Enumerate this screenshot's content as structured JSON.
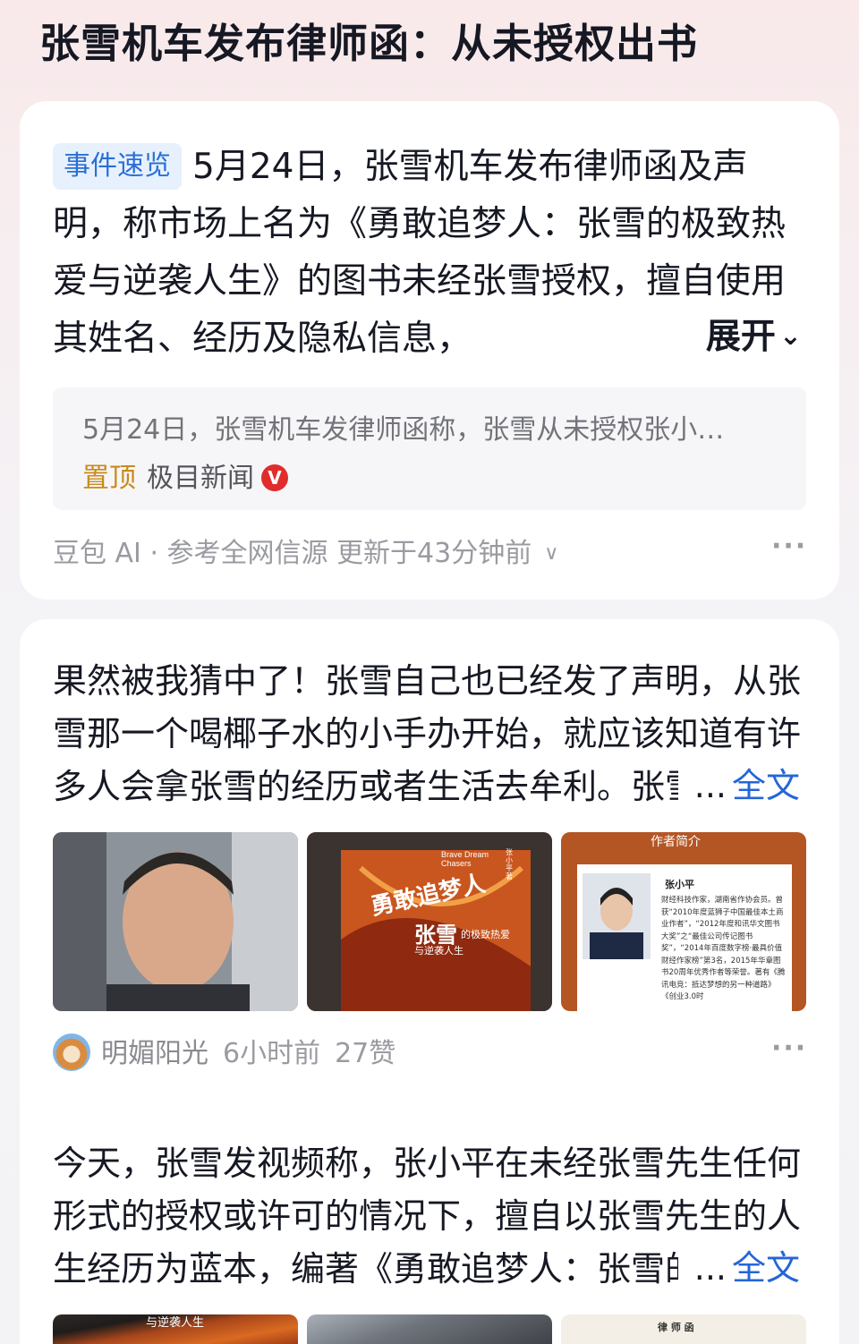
{
  "page": {
    "title": "张雪机车发布律师函：从未授权出书"
  },
  "summary": {
    "tag": "事件速览",
    "text": "5月24日，张雪机车发布律师函及声明，称市场上名为《勇敢追梦人：张雪的极致热爱与逆袭人生》的图书未经张雪授权，擅自使用其姓名、经历及隐私信息，",
    "expand_label": "展开",
    "quote": {
      "text": "5月24日，张雪机车发律师函称，张雪从未授权张小…",
      "pin_label": "置顶",
      "source": "极目新闻",
      "verified_mark": "V"
    },
    "footer": {
      "ai_source": "豆包 AI · 参考全网信源",
      "updated": "更新于43分钟前"
    },
    "more": "···"
  },
  "posts": [
    {
      "text": "果然被我猜中了！张雪自己也已经发了声明，从张雪那一个喝椰子水的小手办开始，就应该知道有许多人会拿张雪的经历或者生活去牟利。张雪",
      "ellipsis": "...",
      "full_label": "全文",
      "images": [
        {
          "alt": "portrait-photo",
          "caption": ""
        },
        {
          "alt": "book-cover",
          "en_title": "Brave Dream Chasers",
          "cn_title": "勇敢追梦人",
          "name": "张雪",
          "subtitle": "的极致热爱",
          "subtitle2": "与逆袭人生",
          "author_vertical": "张小平 著"
        },
        {
          "alt": "author-intro-page",
          "header": "作者简介",
          "author": "张小平",
          "bio": "财经科技作家，湖南省作协会员。曾获“2010年度蓝狮子中国最佳本土商业作者”，“2012年度和讯华文图书大奖”之“最佳公司传记图书奖”，“2014年百度数字榜·最具价值财经作家榜”第3名，2015年华章图书20周年优秀作者等荣誉。著有《腾讯电竞：抵达梦想的另一种道路》《创业3.0时"
        }
      ],
      "author": "明媚阳光",
      "time": "6小时前",
      "likes": "27赞",
      "more": "···"
    },
    {
      "text": "今天，张雪发视频称，张小平在未经张雪先生任何形式的授权或许可的情况下，擅自以张雪先生的人生经历为蓝本，编著《勇敢追梦人：张雪的",
      "ellipsis": "...",
      "full_label": "全文",
      "images": [
        {
          "alt": "book-cover-crop",
          "caption": "与逆袭人生"
        },
        {
          "alt": "portrait-crop",
          "caption": ""
        },
        {
          "alt": "lawyer-letter",
          "caption": "律 师 函"
        }
      ]
    }
  ],
  "colors": {
    "accent_blue": "#2466d8",
    "tag_bg": "#e7f1fd",
    "pin_gold": "#c98a1c",
    "verified_red": "#e02c2c"
  }
}
